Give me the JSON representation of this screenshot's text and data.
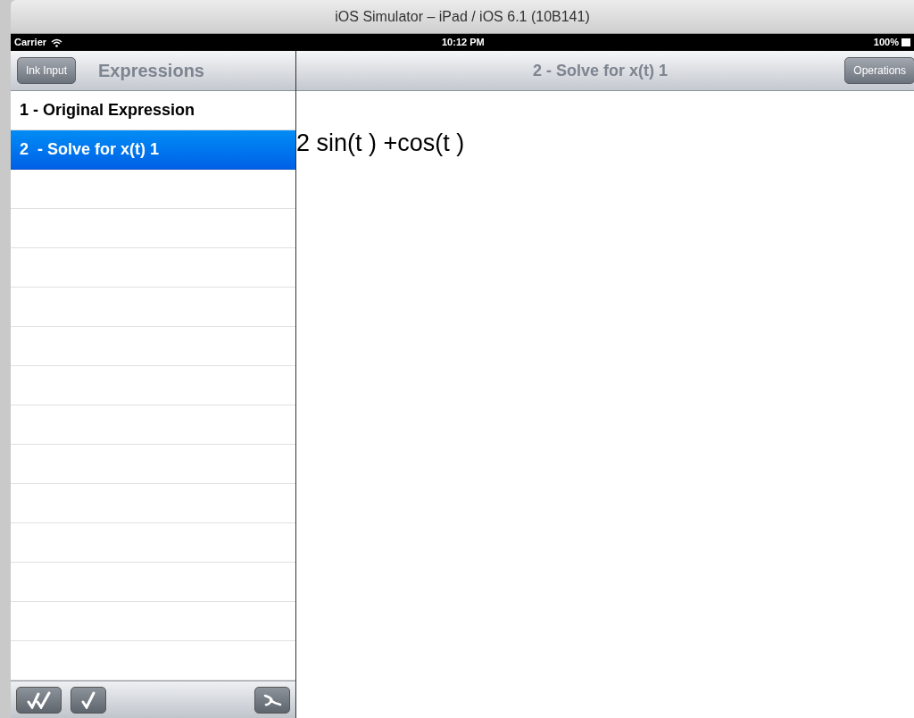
{
  "window": {
    "title": "iOS Simulator – iPad / iOS 6.1 (10B141)"
  },
  "status_bar": {
    "carrier": "Carrier",
    "time": "10:12 PM",
    "battery": "100%"
  },
  "sidebar": {
    "button": "Ink Input",
    "title": "Expressions",
    "items": [
      {
        "label": "1 - Original Expression",
        "selected": false
      },
      {
        "label": "2  - Solve for x(t) 1",
        "selected": true
      }
    ]
  },
  "detail": {
    "title": "2  - Solve for x(t) 1",
    "button": "Operations",
    "expression": "2 sin(t ) +cos(t )"
  }
}
